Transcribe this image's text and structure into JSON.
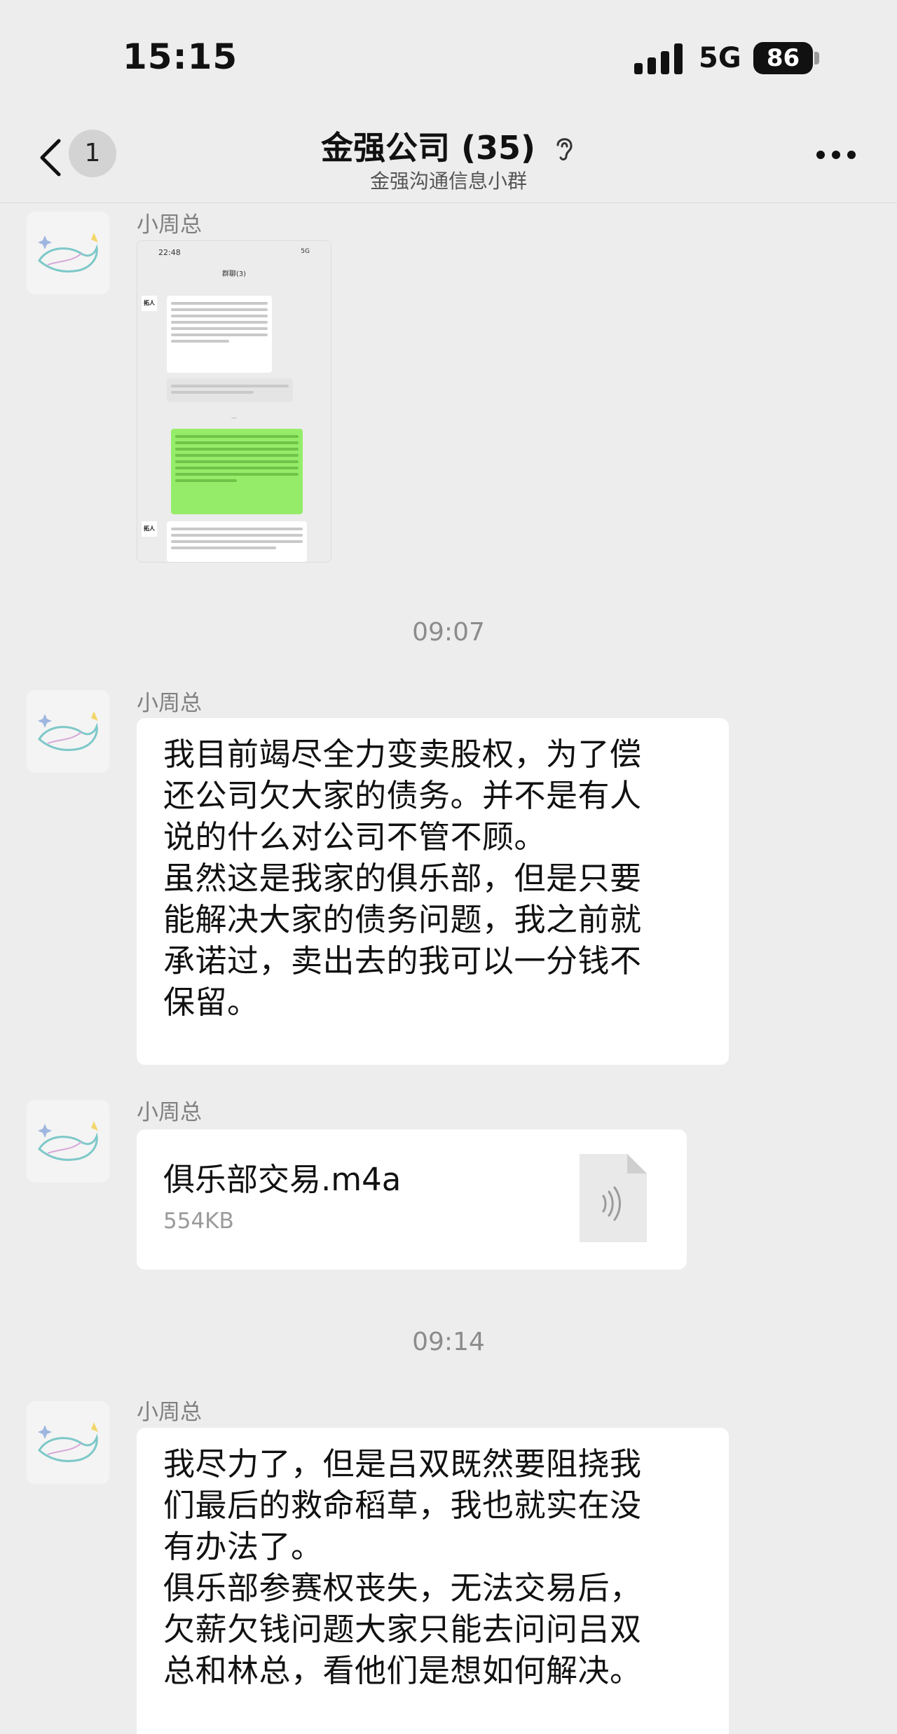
{
  "status_bar": {
    "time": "15:15",
    "network": "5G",
    "battery": "86"
  },
  "header": {
    "back_badge": "1",
    "title": "金强公司 (35)",
    "subtitle": "金强沟通信息小群",
    "icons": [
      "back-chevron-icon",
      "ear-icon",
      "more-icon"
    ]
  },
  "messages": [
    {
      "sender": "小周总",
      "type": "image",
      "screenshot": {
        "time": "22:48",
        "status": "5G",
        "title": "群聊(3)",
        "avatar_label": "拓人"
      }
    },
    {
      "timestamp": "09:07"
    },
    {
      "sender": "小周总",
      "type": "text",
      "lines": [
        "我目前竭尽全力变卖股权，为了偿",
        "还公司欠大家的债务。并不是有人",
        "说的什么对公司不管不顾。",
        "虽然这是我家的俱乐部，但是只要",
        "能解决大家的债务问题，我之前就",
        "承诺过，卖出去的我可以一分钱不",
        "保留。"
      ]
    },
    {
      "sender": "小周总",
      "type": "file",
      "file_name": "俱乐部交易.m4a",
      "file_size": "554KB",
      "icon": "audio-file-icon"
    },
    {
      "timestamp": "09:14"
    },
    {
      "sender": "小周总",
      "type": "text",
      "lines": [
        "我尽力了，但是吕双既然要阻挠我",
        "们最后的救命稻草，我也就实在没",
        "有办法了。",
        "俱乐部参赛权丧失，无法交易后，",
        "欠薪欠钱问题大家只能去问问吕双",
        "总和林总，看他们是想如何解决。"
      ]
    }
  ],
  "colors": {
    "background": "#ededed",
    "bubble": "#ffffff",
    "sender_text": "#808080",
    "timestamp_text": "#8c8c8c"
  }
}
